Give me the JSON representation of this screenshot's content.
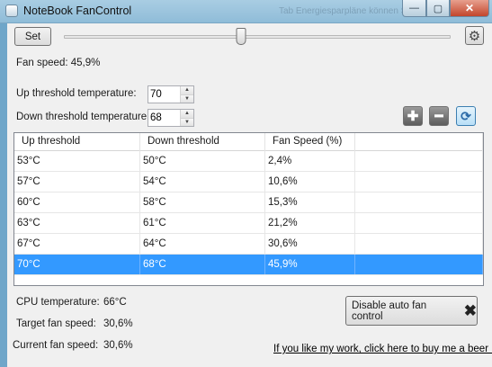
{
  "window": {
    "title": "NoteBook FanControl",
    "caption_background_text": "Tab Energiesparpläne können Sie die Leistung des",
    "minimize_glyph": "—",
    "maximize_glyph": "▢",
    "close_glyph": "✕"
  },
  "toolbar": {
    "set_label": "Set",
    "slider_value_percent": 45.9,
    "gear_icon": "gear-icon"
  },
  "fan_speed_text": "Fan speed: 45,9%",
  "thresholds": {
    "up_label": "Up threshold temperature:",
    "up_value": "70",
    "down_label": "Down threshold temperature:",
    "down_value": "68"
  },
  "actions": {
    "add_icon": "plus-icon",
    "remove_icon": "minus-icon",
    "refresh_icon": "refresh-icon"
  },
  "table": {
    "columns": [
      "Up threshold",
      "Down threshold",
      "Fan Speed (%)",
      ""
    ],
    "rows": [
      {
        "up": "53°C",
        "down": "50°C",
        "speed": "2,4%"
      },
      {
        "up": "57°C",
        "down": "54°C",
        "speed": "10,6%"
      },
      {
        "up": "60°C",
        "down": "58°C",
        "speed": "15,3%"
      },
      {
        "up": "63°C",
        "down": "61°C",
        "speed": "21,2%"
      },
      {
        "up": "67°C",
        "down": "64°C",
        "speed": "30,6%"
      },
      {
        "up": "70°C",
        "down": "68°C",
        "speed": "45,9%"
      }
    ],
    "selected_row": 5
  },
  "status": {
    "cpu_label": "CPU temperature:",
    "cpu_value": "66°C",
    "target_label": "Target fan speed:",
    "target_value": "30,6%",
    "current_label": "Current fan speed:",
    "current_value": "30,6%"
  },
  "disable_button_label": "Disable auto fan control",
  "beer_link_text": "If you like my work, click here to buy me a beer :)",
  "colors": {
    "selection": "#3399ff",
    "titlebar": "#9cc4de"
  }
}
